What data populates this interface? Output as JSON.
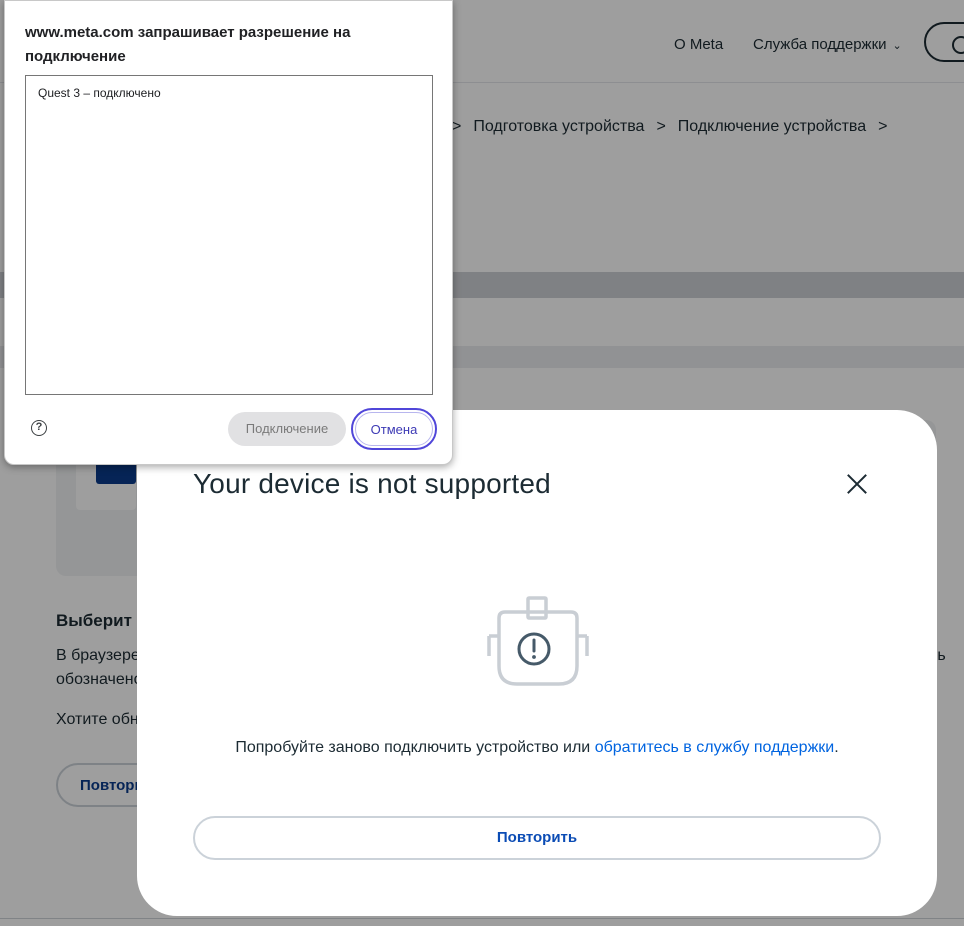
{
  "header": {
    "nav_about": "О Meta",
    "nav_support": "Служба поддержки"
  },
  "breadcrumb": {
    "items": [
      "Подготовка устройства",
      "Подключение устройства"
    ]
  },
  "background": {
    "heading": "Выберит",
    "line1_left": "В браузере",
    "line1_right": "ть",
    "line2": "обозначенo",
    "line3": "Хотите обн",
    "retry_label": "Повтори"
  },
  "modal": {
    "title": "Your device is not supported",
    "message_prefix": "Попробуйте заново подключить устройство или ",
    "message_link": "обратитесь в службу поддержки",
    "message_suffix": ".",
    "retry_label": "Повторить",
    "illustration_icon": "vr-headset-warning-icon"
  },
  "permission_dialog": {
    "title": "www.meta.com запрашивает разрешение на подключение",
    "devices": [
      "Quest 3 – подключено"
    ],
    "help_symbol": "?",
    "connect_label": "Подключение",
    "cancel_label": "Отмена"
  },
  "colors": {
    "link": "#0064e0",
    "primary_text": "#1c2b33",
    "cancel_focus": "#5046d9"
  }
}
